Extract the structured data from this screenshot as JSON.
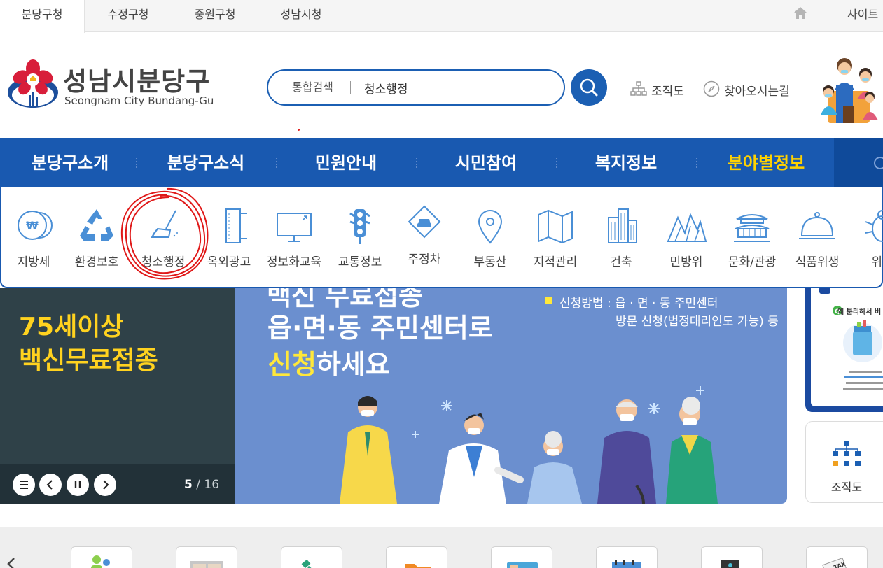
{
  "top_tabs": [
    {
      "label": "분당구청",
      "active": true
    },
    {
      "label": "수정구청",
      "active": false
    },
    {
      "label": "중원구청",
      "active": false
    },
    {
      "label": "성남시청",
      "active": false
    }
  ],
  "top_right": {
    "home_icon": "home-icon",
    "sitemap_label": "사이트"
  },
  "logo": {
    "name_ko": "성남시분당구",
    "name_en": "Seongnam City Bundang-Gu"
  },
  "search": {
    "scope": "통합검색",
    "value": "청소행정",
    "button_icon": "search-icon"
  },
  "util_links": [
    {
      "label": "조직도",
      "icon": "org-chart-icon"
    },
    {
      "label": "찾아오시는길",
      "icon": "compass-icon"
    }
  ],
  "gnb": [
    {
      "label": "분당구소개",
      "active": false
    },
    {
      "label": "분당구소식",
      "active": false
    },
    {
      "label": "민원안내",
      "active": false
    },
    {
      "label": "시민참여",
      "active": false
    },
    {
      "label": "복지정보",
      "active": false
    },
    {
      "label": "분야별정보",
      "active": true
    }
  ],
  "submenu": [
    {
      "label": "지방세",
      "icon": "won-coin-icon"
    },
    {
      "label": "환경보호",
      "icon": "recycle-icon"
    },
    {
      "label": "청소행정",
      "icon": "broom-icon"
    },
    {
      "label": "옥외광고",
      "icon": "billboard-icon"
    },
    {
      "label": "정보화교육",
      "icon": "monitor-icon"
    },
    {
      "label": "교통정보",
      "icon": "traffic-light-icon"
    },
    {
      "label": "주정차",
      "icon": "parking-car-icon"
    },
    {
      "label": "부동산",
      "icon": "map-pin-icon"
    },
    {
      "label": "지적관리",
      "icon": "map-icon"
    },
    {
      "label": "건축",
      "icon": "building-icon"
    },
    {
      "label": "민방위",
      "icon": "mountains-icon"
    },
    {
      "label": "문화/관광",
      "icon": "palace-icon"
    },
    {
      "label": "식품위생",
      "icon": "cloche-icon"
    },
    {
      "label": "위생",
      "icon": "bug-icon"
    }
  ],
  "banner": {
    "left_title_line1": "75세이상",
    "left_title_line2": "백신무료접종",
    "partial_top": "백신 무료접종",
    "main_line1": "읍·면·동 주민센터로",
    "main_line2_highlight": "신청",
    "main_line2_rest": "하세요",
    "info_line1": "신청방법 : 읍 · 면 · 동 주민센터",
    "info_line2": "방문 신청(법정대리인도 가능) 등",
    "current": "5",
    "separator": "/",
    "total": "16",
    "controls": [
      "menu-icon",
      "prev-icon",
      "pause-icon",
      "next-icon"
    ]
  },
  "side": {
    "card_caption": "왜 분리해서 버",
    "org_label": "조직도"
  },
  "colors": {
    "brand_blue": "#1959b0",
    "highlight_yellow": "#ffd200",
    "annotation_red": "#e01818"
  }
}
